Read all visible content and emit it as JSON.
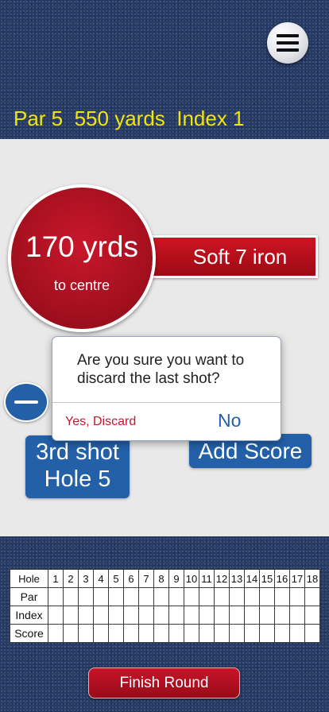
{
  "header": {
    "menu_icon": "hamburger-menu-icon",
    "hole_info": "Par 5  550 yards  Index 1"
  },
  "distance": {
    "value": "170 yrds",
    "subtitle": "to centre"
  },
  "club": {
    "label": "Soft 7 iron"
  },
  "shot": {
    "line1": "3rd shot",
    "line2": "Hole 5"
  },
  "add_score": {
    "label": "Add Score"
  },
  "remove_shot": {
    "icon": "minus-icon"
  },
  "dialog": {
    "message": "Are you sure you want to discard the last shot?",
    "confirm_label": "Yes, Discard",
    "cancel_label": "No"
  },
  "scorecard": {
    "header_label": "Hole",
    "holes": [
      "1",
      "2",
      "3",
      "4",
      "5",
      "6",
      "7",
      "8",
      "9",
      "10",
      "11",
      "12",
      "13",
      "14",
      "15",
      "16",
      "17",
      "18"
    ],
    "row_labels": [
      "Par",
      "Index",
      "Score"
    ]
  },
  "finish": {
    "label": "Finish Round"
  },
  "colors": {
    "accent_red": "#c8142a",
    "accent_blue": "#2360a8",
    "info_yellow": "#f2e40f",
    "panel_grey": "#e9e9e9",
    "background_navy": "#253a66"
  }
}
